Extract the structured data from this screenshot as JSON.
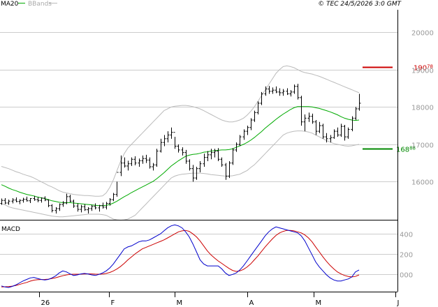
{
  "header": {
    "legend_ma": "MA20",
    "legend_bbands": "BBands",
    "copyright": "© TEC 24/5/2026 3:0 GMT"
  },
  "colors": {
    "price": "#000000",
    "ma": "#00aa00",
    "bbands": "#bbbbbb",
    "grid": "#cccccc",
    "resistance": "#cc0000",
    "support": "#008800",
    "macd": "#0000cc",
    "signal": "#cc0000",
    "axis_text": "#999999"
  },
  "chart_data": [
    {
      "type": "ohlc",
      "legend": [
        "MA20",
        "BBands"
      ],
      "ylim": [
        15000,
        20600
      ],
      "yticks": [
        16000,
        17000,
        18000,
        19000,
        20000
      ],
      "ytick_labels": [
        "16000",
        "17000",
        "18000",
        "19000",
        "20000"
      ],
      "levels": [
        {
          "name": "resistance",
          "value": 19078,
          "label_main": "190",
          "label_sup": "78"
        },
        {
          "name": "support",
          "value": 16888,
          "label_main": "168",
          "label_sup": "88"
        }
      ],
      "bars": [
        [
          15420,
          15550,
          15380,
          15500
        ],
        [
          15500,
          15560,
          15400,
          15430
        ],
        [
          15430,
          15520,
          15380,
          15480
        ],
        [
          15480,
          15560,
          15420,
          15510
        ],
        [
          15510,
          15580,
          15450,
          15470
        ],
        [
          15470,
          15530,
          15400,
          15500
        ],
        [
          15500,
          15570,
          15440,
          15530
        ],
        [
          15530,
          15600,
          15470,
          15490
        ],
        [
          15490,
          15560,
          15430,
          15550
        ],
        [
          15550,
          15620,
          15490,
          15520
        ],
        [
          15520,
          15590,
          15450,
          15500
        ],
        [
          15500,
          15580,
          15440,
          15560
        ],
        [
          15560,
          15610,
          15480,
          15510
        ],
        [
          15510,
          15530,
          15320,
          15360
        ],
        [
          15360,
          15400,
          15180,
          15230
        ],
        [
          15230,
          15320,
          15150,
          15280
        ],
        [
          15280,
          15420,
          15220,
          15390
        ],
        [
          15390,
          15480,
          15330,
          15430
        ],
        [
          15430,
          15680,
          15400,
          15600
        ],
        [
          15600,
          15650,
          15450,
          15480
        ],
        [
          15480,
          15520,
          15300,
          15350
        ],
        [
          15350,
          15420,
          15200,
          15260
        ],
        [
          15260,
          15380,
          15180,
          15330
        ],
        [
          15330,
          15400,
          15220,
          15250
        ],
        [
          15250,
          15320,
          15150,
          15280
        ],
        [
          15280,
          15380,
          15220,
          15340
        ],
        [
          15340,
          15420,
          15260,
          15300
        ],
        [
          15300,
          15380,
          15200,
          15360
        ],
        [
          15360,
          15440,
          15280,
          15320
        ],
        [
          15320,
          15460,
          15260,
          15420
        ],
        [
          15420,
          15560,
          15360,
          15520
        ],
        [
          15520,
          15700,
          15480,
          15660
        ],
        [
          15660,
          16000,
          15600,
          16250
        ],
        [
          16250,
          16700,
          16150,
          16500
        ],
        [
          16500,
          16650,
          16380,
          16420
        ],
        [
          16420,
          16560,
          16300,
          16480
        ],
        [
          16480,
          16650,
          16420,
          16600
        ],
        [
          16600,
          16680,
          16440,
          16500
        ],
        [
          16500,
          16620,
          16400,
          16560
        ],
        [
          16560,
          16700,
          16480,
          16620
        ],
        [
          16620,
          16720,
          16500,
          16580
        ],
        [
          16580,
          16650,
          16350,
          16400
        ],
        [
          16400,
          16500,
          16300,
          16450
        ],
        [
          16450,
          16880,
          16400,
          16820
        ],
        [
          16820,
          17150,
          16780,
          17050
        ],
        [
          17050,
          17250,
          16950,
          17150
        ],
        [
          17150,
          17350,
          17050,
          17250
        ],
        [
          17250,
          17450,
          17150,
          17320
        ],
        [
          17320,
          17200,
          16880,
          16950
        ],
        [
          16950,
          17000,
          16780,
          16850
        ],
        [
          16850,
          16920,
          16700,
          16780
        ],
        [
          16780,
          16850,
          16480,
          16550
        ],
        [
          16550,
          16600,
          16300,
          16350
        ],
        [
          16350,
          16450,
          16000,
          16100
        ],
        [
          16100,
          16400,
          16050,
          16350
        ],
        [
          16350,
          16550,
          16250,
          16480
        ],
        [
          16480,
          16750,
          16400,
          16650
        ],
        [
          16650,
          16820,
          16550,
          16720
        ],
        [
          16720,
          16880,
          16600,
          16780
        ],
        [
          16780,
          16880,
          16650,
          16820
        ],
        [
          16820,
          16900,
          16550,
          16600
        ],
        [
          16600,
          16650,
          16400,
          16450
        ],
        [
          16450,
          16500,
          16050,
          16150
        ],
        [
          16150,
          16550,
          16100,
          16500
        ],
        [
          16500,
          16900,
          16450,
          16850
        ],
        [
          16850,
          17050,
          16800,
          17000
        ],
        [
          17000,
          17250,
          16950,
          17200
        ],
        [
          17200,
          17400,
          17120,
          17350
        ],
        [
          17350,
          17500,
          17250,
          17450
        ],
        [
          17450,
          17700,
          17380,
          17650
        ],
        [
          17650,
          17900,
          17600,
          17850
        ],
        [
          17850,
          18150,
          17800,
          18100
        ],
        [
          18100,
          18400,
          18050,
          18350
        ],
        [
          18350,
          18550,
          18300,
          18480
        ],
        [
          18480,
          18560,
          18350,
          18420
        ],
        [
          18420,
          18520,
          18350,
          18450
        ],
        [
          18450,
          18550,
          18370,
          18400
        ],
        [
          18400,
          18500,
          18300,
          18380
        ],
        [
          18380,
          18480,
          18300,
          18420
        ],
        [
          18420,
          18500,
          18320,
          18350
        ],
        [
          18350,
          18450,
          18280,
          18400
        ],
        [
          18400,
          18600,
          18350,
          18550
        ],
        [
          18550,
          18620,
          18200,
          18250
        ],
        [
          18250,
          18300,
          17500,
          17600
        ],
        [
          17600,
          17800,
          17350,
          17700
        ],
        [
          17700,
          17850,
          17600,
          17750
        ],
        [
          17750,
          17820,
          17550,
          17600
        ],
        [
          17600,
          17650,
          17250,
          17350
        ],
        [
          17350,
          17600,
          17300,
          17500
        ],
        [
          17500,
          17550,
          17150,
          17200
        ],
        [
          17200,
          17300,
          17050,
          17150
        ],
        [
          17150,
          17250,
          17050,
          17180
        ],
        [
          17180,
          17400,
          17150,
          17350
        ],
        [
          17350,
          17450,
          17200,
          17250
        ],
        [
          17250,
          17550,
          17200,
          17480
        ],
        [
          17480,
          17520,
          17100,
          17200
        ],
        [
          17200,
          17450,
          17150,
          17400
        ],
        [
          17400,
          17750,
          17350,
          17700
        ],
        [
          17700,
          18000,
          17650,
          17950
        ],
        [
          17950,
          18350,
          17900,
          18100
        ]
      ],
      "ma20": [
        15920,
        15880,
        15830,
        15790,
        15760,
        15720,
        15690,
        15660,
        15640,
        15620,
        15590,
        15570,
        15550,
        15520,
        15490,
        15470,
        15450,
        15440,
        15440,
        15440,
        15430,
        15420,
        15410,
        15400,
        15390,
        15380,
        15370,
        15360,
        15360,
        15370,
        15390,
        15430,
        15480,
        15540,
        15600,
        15650,
        15710,
        15760,
        15810,
        15860,
        15910,
        15960,
        16010,
        16080,
        16160,
        16240,
        16330,
        16420,
        16490,
        16560,
        16620,
        16680,
        16710,
        16730,
        16740,
        16760,
        16790,
        16800,
        16820,
        16830,
        16840,
        16850,
        16850,
        16860,
        16880,
        16920,
        16960,
        17000,
        17050,
        17110,
        17180,
        17260,
        17340,
        17430,
        17510,
        17590,
        17670,
        17740,
        17810,
        17870,
        17930,
        17980,
        18010,
        18010,
        18010,
        18010,
        18000,
        17980,
        17960,
        17930,
        17900,
        17870,
        17830,
        17790,
        17740,
        17700,
        17670,
        17650,
        17640,
        17650
      ],
      "bb_upper": [
        16410,
        16380,
        16350,
        16310,
        16270,
        16240,
        16200,
        16170,
        16140,
        16100,
        16050,
        16000,
        15950,
        15900,
        15860,
        15810,
        15760,
        15720,
        15700,
        15680,
        15660,
        15650,
        15640,
        15630,
        15630,
        15620,
        15610,
        15610,
        15620,
        15700,
        15850,
        16050,
        16300,
        16550,
        16750,
        16900,
        17000,
        17100,
        17200,
        17300,
        17400,
        17500,
        17600,
        17700,
        17800,
        17900,
        17950,
        18000,
        18020,
        18030,
        18040,
        18040,
        18030,
        18010,
        17980,
        17950,
        17900,
        17850,
        17800,
        17750,
        17700,
        17650,
        17620,
        17600,
        17600,
        17620,
        17650,
        17700,
        17780,
        17880,
        18000,
        18150,
        18300,
        18450,
        18600,
        18750,
        18900,
        19000,
        19080,
        19100,
        19080,
        19050,
        19000,
        18950,
        18920,
        18900,
        18880,
        18850,
        18820,
        18780,
        18740,
        18700,
        18660,
        18620,
        18580,
        18540,
        18500,
        18460,
        18420,
        18380
      ],
      "bb_lower": [
        15420,
        15380,
        15330,
        15300,
        15280,
        15260,
        15240,
        15220,
        15200,
        15180,
        15160,
        15140,
        15120,
        15100,
        15080,
        15070,
        15060,
        15060,
        15070,
        15080,
        15090,
        15100,
        15110,
        15120,
        15130,
        15130,
        15130,
        15130,
        15120,
        15100,
        15050,
        15000,
        14980,
        14970,
        14980,
        15000,
        15050,
        15100,
        15200,
        15300,
        15400,
        15500,
        15600,
        15700,
        15800,
        15900,
        16000,
        16100,
        16150,
        16180,
        16200,
        16210,
        16220,
        16230,
        16230,
        16230,
        16220,
        16210,
        16190,
        16180,
        16170,
        16160,
        16150,
        16150,
        16160,
        16180,
        16200,
        16250,
        16300,
        16380,
        16450,
        16550,
        16650,
        16750,
        16850,
        16950,
        17050,
        17150,
        17250,
        17300,
        17330,
        17350,
        17360,
        17360,
        17350,
        17330,
        17300,
        17250,
        17200,
        17150,
        17100,
        17060,
        17020,
        17000,
        16980,
        16960,
        16950,
        16960,
        16980,
        17000
      ]
    },
    {
      "type": "line",
      "title": "MACD",
      "ylim": [
        -170,
        520
      ],
      "yticks": [
        0,
        200,
        400
      ],
      "ytick_labels": [
        "000",
        "200",
        "400"
      ],
      "series": [
        {
          "values": [
            -120,
            -130,
            -135,
            -125,
            -110,
            -90,
            -70,
            -55,
            -40,
            -35,
            -45,
            -55,
            -60,
            -55,
            -40,
            -20,
            10,
            30,
            20,
            0,
            -15,
            -10,
            0,
            5,
            0,
            -10,
            -15,
            -5,
            10,
            30,
            60,
            100,
            150,
            200,
            250,
            270,
            280,
            300,
            320,
            330,
            330,
            340,
            360,
            380,
            400,
            430,
            460,
            480,
            490,
            480,
            460,
            420,
            370,
            300,
            220,
            140,
            100,
            80,
            80,
            80,
            80,
            50,
            10,
            -15,
            -5,
            10,
            40,
            80,
            130,
            180,
            230,
            280,
            330,
            380,
            420,
            450,
            470,
            460,
            450,
            440,
            430,
            420,
            410,
            380,
            330,
            260,
            190,
            120,
            70,
            30,
            -10,
            -40,
            -60,
            -70,
            -70,
            -60,
            -50,
            -30,
            20,
            40
          ]
        },
        {
          "values": [
            -130,
            -128,
            -126,
            -122,
            -115,
            -105,
            -95,
            -85,
            -72,
            -62,
            -58,
            -56,
            -55,
            -52,
            -45,
            -38,
            -28,
            -18,
            -10,
            -5,
            -3,
            -3,
            -2,
            0,
            1,
            0,
            -2,
            -3,
            -1,
            5,
            15,
            30,
            50,
            75,
            105,
            140,
            170,
            200,
            225,
            250,
            265,
            280,
            295,
            310,
            325,
            340,
            360,
            380,
            400,
            420,
            430,
            435,
            425,
            400,
            370,
            330,
            280,
            230,
            190,
            160,
            130,
            105,
            80,
            55,
            35,
            25,
            30,
            45,
            70,
            100,
            140,
            180,
            225,
            270,
            310,
            350,
            385,
            410,
            425,
            435,
            435,
            430,
            420,
            410,
            390,
            360,
            320,
            270,
            220,
            170,
            125,
            85,
            50,
            20,
            0,
            -15,
            -25,
            -30,
            -25,
            -10
          ]
        }
      ]
    }
  ],
  "x_axis": {
    "labels": [
      "26",
      "F",
      "M",
      "A",
      "M",
      "J"
    ]
  }
}
